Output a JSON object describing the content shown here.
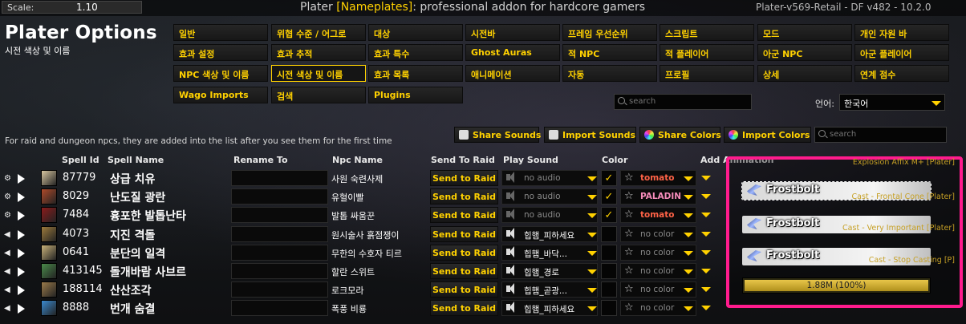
{
  "topbar": {
    "scale_label": "Scale:",
    "scale_value": "1.10",
    "title_prefix": "Plater ",
    "title_bracket": "[Nameplates]",
    "title_suffix": ": professional addon for hardcore gamers",
    "version": "Plater-v569-Retail - DF v482 - 10.2.0"
  },
  "header": {
    "title": "Plater Options",
    "subtitle": "시전 색상 및 이름"
  },
  "tabs": [
    [
      "일반",
      "위협 수준 / 어그로",
      "대상",
      "시전바",
      "프레임 우선순위",
      "스크립트",
      "모드",
      "개인 자원 바"
    ],
    [
      "효과 설정",
      "효과 추적",
      "효과 특수",
      "Ghost Auras",
      "적 NPC",
      "적 플레이어",
      "아군 NPC",
      "아군 플레이어"
    ],
    [
      "NPC 색상 및 이름",
      "시전 색상 및 이름",
      "효과 목록",
      "애니메이션",
      "자동",
      "프로필",
      "상세",
      "연계 점수"
    ],
    [
      "Wago Imports",
      "검색",
      "Plugins"
    ]
  ],
  "active_tab": "시전 색상 및 이름",
  "search": {
    "placeholder_top": "search",
    "placeholder_table": "search"
  },
  "language": {
    "label": "언어:",
    "value": "한국어"
  },
  "info_text": "For raid and dungeon npcs, they are added into the list after you see them for the first time",
  "actions": {
    "share_sounds": "Share Sounds",
    "import_sounds": "Import Sounds",
    "share_colors": "Share Colors",
    "import_colors": "Import Colors"
  },
  "columns": {
    "spell_id": "Spell Id",
    "spell_name": "Spell Name",
    "rename_to": "Rename To",
    "npc_name": "Npc Name",
    "send_to_raid": "Send To Raid",
    "play_sound": "Play Sound",
    "color": "Color",
    "add_animation": "Add Animation"
  },
  "rows": [
    {
      "ctrl": "gear",
      "spell_id": "87779",
      "spell_name": "상급 치유",
      "npc": "사원 숙련사제",
      "send": "Send to Raid",
      "sound": "no audio",
      "sound_set": false,
      "checked": true,
      "color": "tomato",
      "color_hex": "#ff6347",
      "icon_color": "#d8c7a0"
    },
    {
      "ctrl": "gear",
      "spell_id": "8029",
      "spell_name": "난도질 광란",
      "npc": "유혈이빨",
      "send": "Send to Raid",
      "sound": "no audio",
      "sound_set": false,
      "checked": true,
      "color": "PALADIN",
      "color_hex": "#f58cba",
      "icon_color": "#b04a2a"
    },
    {
      "ctrl": "gear",
      "spell_id": "7484",
      "spell_name": "흉포한 발톱난타",
      "npc": "발톱 싸움꾼",
      "send": "Send to Raid",
      "sound": "no audio",
      "sound_set": false,
      "checked": true,
      "color": "tomato",
      "color_hex": "#ff6347",
      "icon_color": "#8a1c1c"
    },
    {
      "ctrl": "speaker",
      "spell_id": "4073",
      "spell_name": "지진 격돌",
      "npc": "원시술사 흙점쟁이",
      "send": "Send to Raid",
      "sound": "힙햄_피하세요",
      "sound_set": true,
      "checked": false,
      "color": "no color",
      "color_hex": "#888888",
      "icon_color": "#9c7a3c"
    },
    {
      "ctrl": "speaker",
      "spell_id": "0641",
      "spell_name": "분단의 일격",
      "npc": "무한의 수호자 티르",
      "send": "Send to Raid",
      "sound": "힙햄_바닥...",
      "sound_set": true,
      "checked": false,
      "color": "no color",
      "color_hex": "#888888",
      "icon_color": "#c9b27a"
    },
    {
      "ctrl": "speaker",
      "spell_id": "413145",
      "spell_name": "돌개바람 사브르",
      "npc": "할란 스위트",
      "send": "Send to Raid",
      "sound": "힙햄_경로",
      "sound_set": true,
      "checked": false,
      "color": "no color",
      "color_hex": "#888888",
      "icon_color": "#4a8a4a"
    },
    {
      "ctrl": "speaker",
      "spell_id": "188114",
      "spell_name": "산산조각",
      "npc": "로크모라",
      "send": "Send to Raid",
      "sound": "힙햄_곧광...",
      "sound_set": true,
      "checked": false,
      "color": "no color",
      "color_hex": "#888888",
      "icon_color": "#9a7a4a"
    },
    {
      "ctrl": "speaker",
      "spell_id": "8888",
      "spell_name": "번개 숨결",
      "npc": "폭풍 비룡",
      "send": "Send to Raid",
      "sound": "힙햄_피하세요",
      "sound_set": true,
      "checked": false,
      "color": "no color",
      "color_hex": "#888888",
      "icon_color": "#3a8ad0"
    }
  ],
  "preview": {
    "plates": [
      {
        "label": "Explosion Affix M+ [Plater]",
        "spell": "Frostbolt"
      },
      {
        "label": "Cast - Frontal Cone [Plater]",
        "spell": "Frostbolt"
      },
      {
        "label": "Cast - Very Important [Plater]",
        "spell": "Frostbolt"
      },
      {
        "label": "Cast - Stop Casting [P]",
        "spell": ""
      }
    ],
    "health_text": "1.88M (100%)",
    "health_fraction": 1.0
  },
  "colors": {
    "accent": "#ffd100",
    "highlight": "#ff1b8d"
  }
}
